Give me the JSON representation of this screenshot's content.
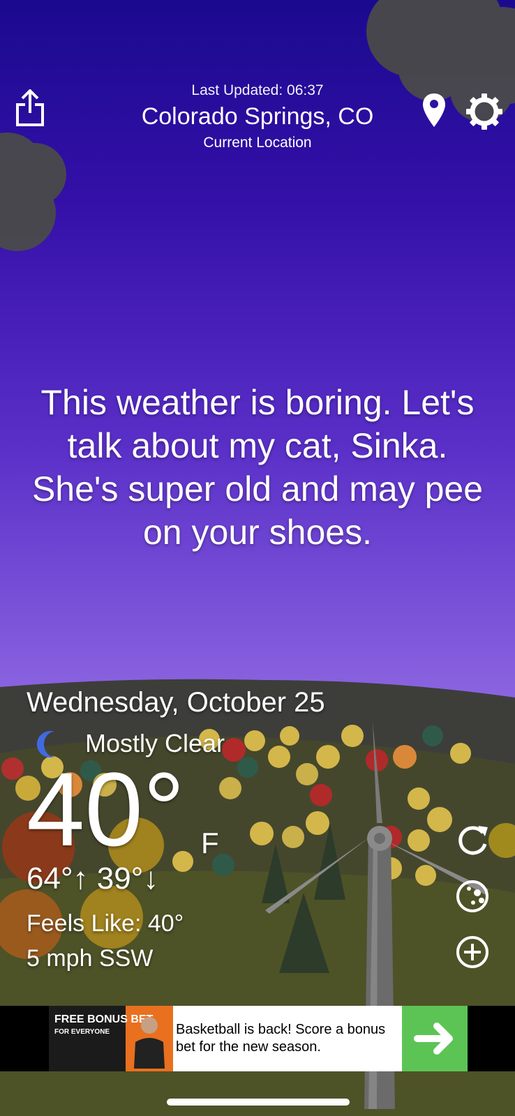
{
  "header": {
    "last_updated": "Last Updated: 06:37",
    "location": "Colorado Springs, CO",
    "location_sub": "Current Location"
  },
  "message": "This weather is boring. Let's talk about my cat, Sinka. She's super old and may pee on your shoes.",
  "weather": {
    "date": "Wednesday, October 25",
    "condition": "Mostly Clear",
    "condition_icon": "moon-icon",
    "temperature": "40°",
    "unit": "F",
    "high_low": "64°↑ 39°↓",
    "feels_like": "Feels Like: 40°",
    "wind": "5 mph SSW"
  },
  "ad": {
    "image_title": "FREE BONUS BET",
    "image_sub": "FOR EVERYONE",
    "text": "Basketball is back! Score a bonus bet for the new season."
  },
  "icons": {
    "share": "share-icon",
    "location": "location-pin-icon",
    "settings": "gear-icon",
    "refresh": "refresh-icon",
    "radar": "radar-icon",
    "add": "add-circle-icon"
  },
  "colors": {
    "sky_top": "#1a0a8f",
    "sky_bottom": "#b39aee",
    "hill_dark": "#3d3e3a",
    "ground": "#4e5227",
    "ad_cta": "#5cc454"
  }
}
